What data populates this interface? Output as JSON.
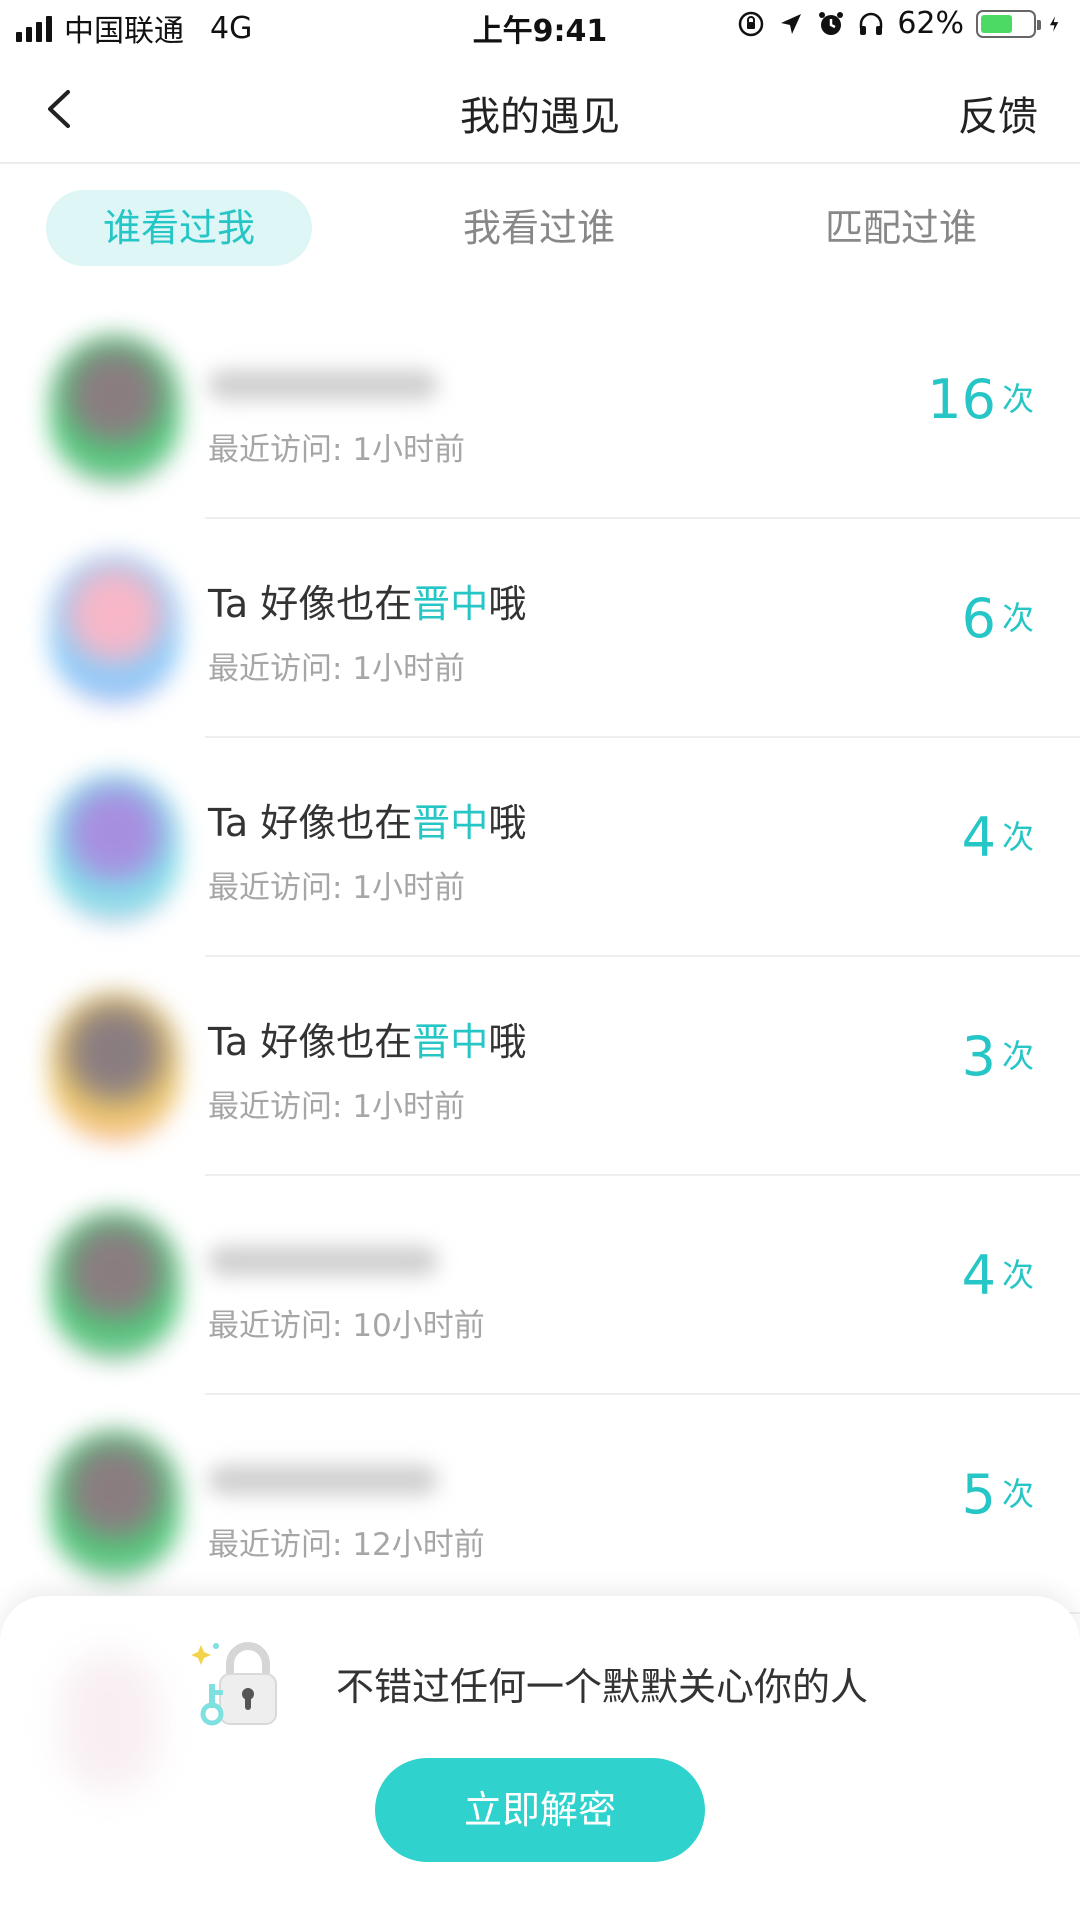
{
  "status_bar": {
    "carrier": "中国联通",
    "network": "4G",
    "time": "上午9:41",
    "battery_percent": "62%",
    "battery_level": 0.62,
    "battery_color": "#4cd964"
  },
  "nav": {
    "title": "我的遇见",
    "right_action": "反馈",
    "back_icon": "chevron-left-icon"
  },
  "tabs": [
    {
      "label": "谁看过我",
      "active": true
    },
    {
      "label": "我看过谁",
      "active": false
    },
    {
      "label": "匹配过谁",
      "active": false
    }
  ],
  "colors": {
    "accent": "#26c6c6",
    "button": "#2fd2cd",
    "tab_active_bg": "#dff6f7"
  },
  "visitors": [
    {
      "title": null,
      "visit_label": "最近访问:",
      "visit_time": "1小时前",
      "count": "16",
      "unit": "次",
      "avatar_colors": [
        "#4ad27a",
        "#8a7d80",
        "#f4a3d8"
      ]
    },
    {
      "title_prefix": "Ta 好像也在",
      "title_highlight": "晋中",
      "title_suffix": "哦",
      "visit_label": "最近访问:",
      "visit_time": "1小时前",
      "count": "6",
      "unit": "次",
      "avatar_colors": [
        "#7fd0ff",
        "#f7b7c8",
        "#f4a3d8"
      ]
    },
    {
      "title_prefix": "Ta 好像也在",
      "title_highlight": "晋中",
      "title_suffix": "哦",
      "visit_label": "最近访问:",
      "visit_time": "1小时前",
      "count": "4",
      "unit": "次",
      "avatar_colors": [
        "#7fe9ec",
        "#a78fe0",
        "#f4a3d8"
      ]
    },
    {
      "title_prefix": "Ta 好像也在",
      "title_highlight": "晋中",
      "title_suffix": "哦",
      "visit_label": "最近访问:",
      "visit_time": "1小时前",
      "count": "3",
      "unit": "次",
      "avatar_colors": [
        "#f5cf6a",
        "#8a7d80",
        "#f4a3d8"
      ]
    },
    {
      "title": null,
      "visit_label": "最近访问:",
      "visit_time": "10小时前",
      "count": "4",
      "unit": "次",
      "avatar_colors": [
        "#4ad27a",
        "#8a7d80",
        "#f4a3d8"
      ]
    },
    {
      "title": null,
      "visit_label": "最近访问:",
      "visit_time": "12小时前",
      "count": "5",
      "unit": "次",
      "avatar_colors": [
        "#4ad27a",
        "#8a7d80",
        "#f4a3d8"
      ]
    }
  ],
  "unlock_sheet": {
    "icon": "lock-key-icon",
    "message": "不错过任何一个默默关心你的人",
    "button_label": "立即解密"
  }
}
